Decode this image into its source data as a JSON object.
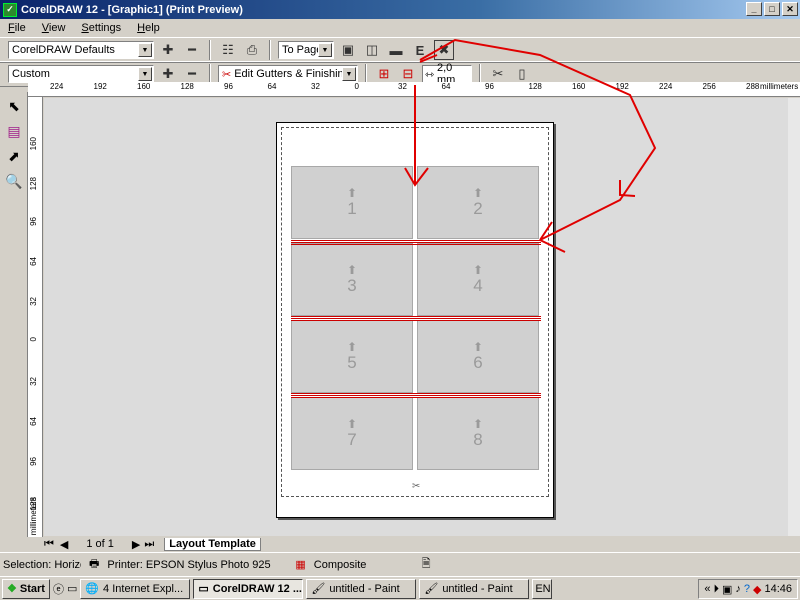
{
  "window": {
    "title": "CorelDRAW 12 - [Graphic1] (Print Preview)",
    "min": "_",
    "max": "□",
    "close": "✕"
  },
  "menu": {
    "items": [
      "File",
      "View",
      "Settings",
      "Help"
    ]
  },
  "toolbar1": {
    "preset": "CorelDRAW Defaults",
    "zoom": "To Page",
    "e_label": "E"
  },
  "toolbar2": {
    "layout": "Custom",
    "gutters": "Edit Gutters & Finishing",
    "gutter_value": "2,0 mm"
  },
  "ruler": {
    "h_ticks": [
      "224",
      "192",
      "160",
      "128",
      "96",
      "64",
      "32",
      "0",
      "32",
      "64",
      "96",
      "128",
      "160",
      "192",
      "224",
      "256",
      "288"
    ],
    "h_unit": "millimeters",
    "v_ticks": [
      "160",
      "128",
      "96",
      "64",
      "32",
      "0",
      "32",
      "64",
      "96",
      "128"
    ],
    "v_unit": "millimeters"
  },
  "cells": [
    "1",
    "2",
    "3",
    "4",
    "5",
    "6",
    "7",
    "8"
  ],
  "page_nav": {
    "text": "1 of 1",
    "tab": "Layout Template"
  },
  "status": {
    "selection": "Selection: Horizon...",
    "printer": "Printer: EPSON Stylus Photo 925",
    "mode": "Composite"
  },
  "taskbar": {
    "start": "Start",
    "tasks": [
      "4 Internet Expl...",
      "CorelDRAW 12 ...",
      "untitled - Paint",
      "untitled - Paint"
    ],
    "lang": "EN",
    "clock": "14:46"
  },
  "colors": {
    "title_start": "#0a246a",
    "annotation": "#e00000"
  }
}
